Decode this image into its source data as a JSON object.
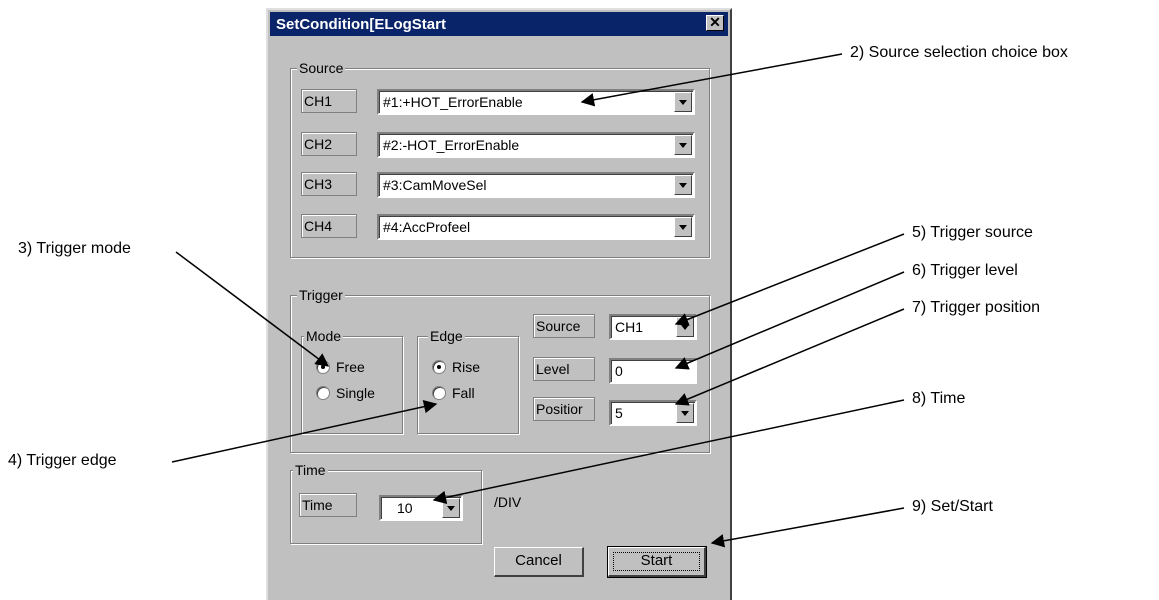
{
  "window": {
    "title": "SetCondition[ELogStart",
    "close_glyph": "✕"
  },
  "source": {
    "group_title": "Source",
    "channels": [
      {
        "label": "CH1",
        "value": "#1:+HOT_ErrorEnable"
      },
      {
        "label": "CH2",
        "value": "#2:-HOT_ErrorEnable"
      },
      {
        "label": "CH3",
        "value": "#3:CamMoveSel"
      },
      {
        "label": "CH4",
        "value": "#4:AccProfeel"
      }
    ]
  },
  "trigger": {
    "group_title": "Trigger",
    "mode": {
      "title": "Mode",
      "options": [
        "Free",
        "Single"
      ],
      "selected": "Free"
    },
    "edge": {
      "title": "Edge",
      "options": [
        "Rise",
        "Fall"
      ],
      "selected": "Rise"
    },
    "source_label": "Source",
    "source_value": "CH1",
    "level_label": "Level",
    "level_value": "0",
    "position_label": "Positior",
    "position_value": "5"
  },
  "time": {
    "group_title": "Time",
    "label": "Time",
    "value": "10",
    "unit": "/DIV"
  },
  "buttons": {
    "cancel": "Cancel",
    "start": "Start"
  },
  "annotations": {
    "source_choice": "2) Source selection choice box",
    "trigger_mode": "3) Trigger mode",
    "trigger_edge": "4) Trigger edge",
    "trigger_source": "5) Trigger source",
    "trigger_level": "6) Trigger level",
    "trigger_position": "7) Trigger position",
    "time": "8) Time",
    "set_start": "9) Set/Start"
  }
}
